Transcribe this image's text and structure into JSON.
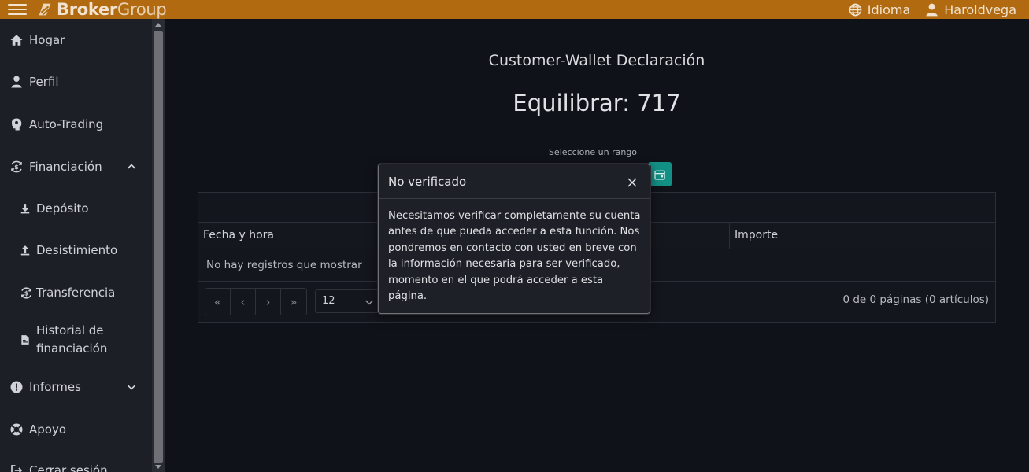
{
  "header": {
    "brand_bold": "Broker",
    "brand_light": "Group",
    "language_label": "Idioma",
    "user_name": "Haroldvega"
  },
  "sidebar": {
    "items": [
      {
        "label": "Hogar",
        "icon": "home-icon"
      },
      {
        "label": "Perfil",
        "icon": "user-icon"
      },
      {
        "label": "Auto-Trading",
        "icon": "brain-icon"
      },
      {
        "label": "Financiación",
        "icon": "money-cycle-icon",
        "expanded": true
      },
      {
        "label": "Depósito",
        "icon": "download-icon"
      },
      {
        "label": "Desistimiento",
        "icon": "upload-icon"
      },
      {
        "label": "Transferencia",
        "icon": "transfer-icon"
      },
      {
        "label_line1": "Historial de",
        "label_line2": "financiación",
        "icon": "file-invoice-icon"
      },
      {
        "label": "Informes",
        "icon": "exclamation-circle-icon",
        "expanded": false
      },
      {
        "label": "Apoyo",
        "icon": "life-ring-icon"
      },
      {
        "label": "Cerrar sesión",
        "icon": "sign-out-icon"
      }
    ]
  },
  "main": {
    "title": "Customer-Wallet Declaración",
    "balance": "Equilibrar: 717",
    "range_label": "Seleccione un rango",
    "table": {
      "columns": [
        "Fecha y hora",
        "Importe"
      ],
      "empty_message": "No hay registros que mostrar",
      "pager": [
        "«",
        "‹",
        "›",
        "»"
      ],
      "per_page": "12",
      "pages_info": "0 de 0 páginas (0 artículos)"
    }
  },
  "modal": {
    "title": "No verificado",
    "body": "Necesitamos verificar completamente su cuenta antes de que pueda acceder a esta función. Nos pondremos en contacto con usted en breve con la información necesaria para ser verificado, momento en el que podrá acceder a esta página."
  },
  "colors": {
    "topbar": "#b26a10",
    "background": "#10121a",
    "sidebar": "#1d1f27",
    "accent_teal": "#139085"
  }
}
